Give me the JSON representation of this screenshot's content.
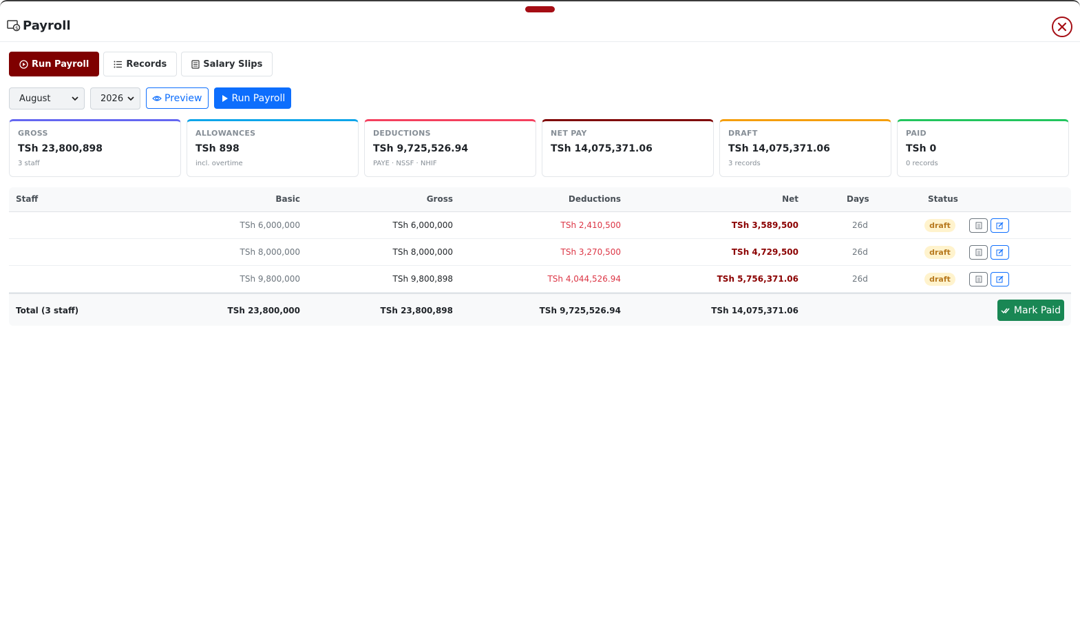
{
  "window": {
    "title": "Payroll"
  },
  "tabs": [
    {
      "label": "Run Payroll",
      "active": true,
      "icon": "play-circle-icon"
    },
    {
      "label": "Records",
      "active": false,
      "icon": "list-icon"
    },
    {
      "label": "Salary Slips",
      "active": false,
      "icon": "document-icon"
    }
  ],
  "controls": {
    "month": "August",
    "year": "2026",
    "preview_label": "Preview",
    "run_label": "Run Payroll"
  },
  "cards": [
    {
      "label": "GROSS",
      "value": "TSh 23,800,898",
      "sub": "3 staff",
      "color": "#6366f1"
    },
    {
      "label": "ALLOWANCES",
      "value": "TSh 898",
      "sub": "incl. overtime",
      "color": "#0ea5e9"
    },
    {
      "label": "DEDUCTIONS",
      "value": "TSh 9,725,526.94",
      "sub": "PAYE · NSSF · NHIF",
      "color": "#f43f5e"
    },
    {
      "label": "NET PAY",
      "value": "TSh 14,075,371.06",
      "sub": "",
      "color": "#7f0000"
    },
    {
      "label": "DRAFT",
      "value": "TSh 14,075,371.06",
      "sub": "3 records",
      "color": "#f59e0b"
    },
    {
      "label": "PAID",
      "value": "TSh 0",
      "sub": "0 records",
      "color": "#22c55e"
    }
  ],
  "table": {
    "headers": {
      "staff": "Staff",
      "basic": "Basic",
      "gross": "Gross",
      "deductions": "Deductions",
      "net": "Net",
      "days": "Days",
      "status": "Status"
    },
    "rows": [
      {
        "staff": "",
        "basic": "TSh 6,000,000",
        "gross": "TSh 6,000,000",
        "deductions": "TSh 2,410,500",
        "net": "TSh 3,589,500",
        "days": "26d",
        "status": "draft"
      },
      {
        "staff": "",
        "basic": "TSh 8,000,000",
        "gross": "TSh 8,000,000",
        "deductions": "TSh 3,270,500",
        "net": "TSh 4,729,500",
        "days": "26d",
        "status": "draft"
      },
      {
        "staff": "",
        "basic": "TSh 9,800,000",
        "gross": "TSh 9,800,898",
        "deductions": "TSh 4,044,526.94",
        "net": "TSh 5,756,371.06",
        "days": "26d",
        "status": "draft"
      }
    ],
    "footer": {
      "label": "Total (3 staff)",
      "basic": "TSh 23,800,000",
      "gross": "TSh 23,800,898",
      "deductions": "TSh 9,725,526.94",
      "net": "TSh 14,075,371.06",
      "mark_paid_label": "Mark Paid"
    }
  }
}
